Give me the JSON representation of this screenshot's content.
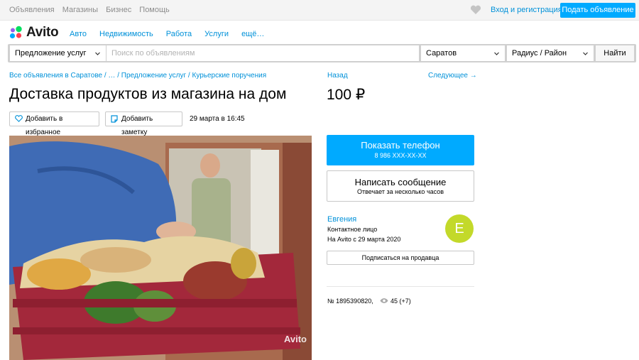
{
  "topbar": {
    "nav": [
      "Объявления",
      "Магазины",
      "Бизнес",
      "Помощь"
    ],
    "login": "Вход и регистрация",
    "post_ad": "Подать объявление"
  },
  "logo": {
    "text": "Avito"
  },
  "catnav": [
    "Авто",
    "Недвижимость",
    "Работа",
    "Услуги",
    "ещё…"
  ],
  "search": {
    "category": "Предложение услуг",
    "placeholder": "Поиск по объявлениям",
    "city": "Саратов",
    "radius": "Радиус / Район",
    "button": "Найти"
  },
  "breadcrumb": "Все объявления в Саратове / … / Предложение услуг / Курьерские поручения",
  "nav": {
    "back": "Назад",
    "next": "Следующее →"
  },
  "listing": {
    "title": "Доставка продуктов из магазина на дом",
    "price": "100 ₽",
    "add_favorite": "Добавить в избранное",
    "add_note": "Добавить заметку",
    "date": "29 марта в 16:45",
    "watermark": "Avito",
    "number": "№ 1895390820,",
    "views": "45 (+7)"
  },
  "contact": {
    "show_phone": "Показать телефон",
    "phone": "8 986 XXX-XX-XX",
    "write_message": "Написать сообщение",
    "reply_time": "Отвечает за несколько часов",
    "seller_name": "Евгения",
    "seller_role": "Контактное лицо",
    "seller_since": "На Avito с 29 марта 2020",
    "avatar_letter": "Е",
    "subscribe": "Подписаться на продавца"
  },
  "colors": {
    "accent": "#00aaff",
    "link": "#0091d9",
    "avatar": "#c3d92a"
  }
}
